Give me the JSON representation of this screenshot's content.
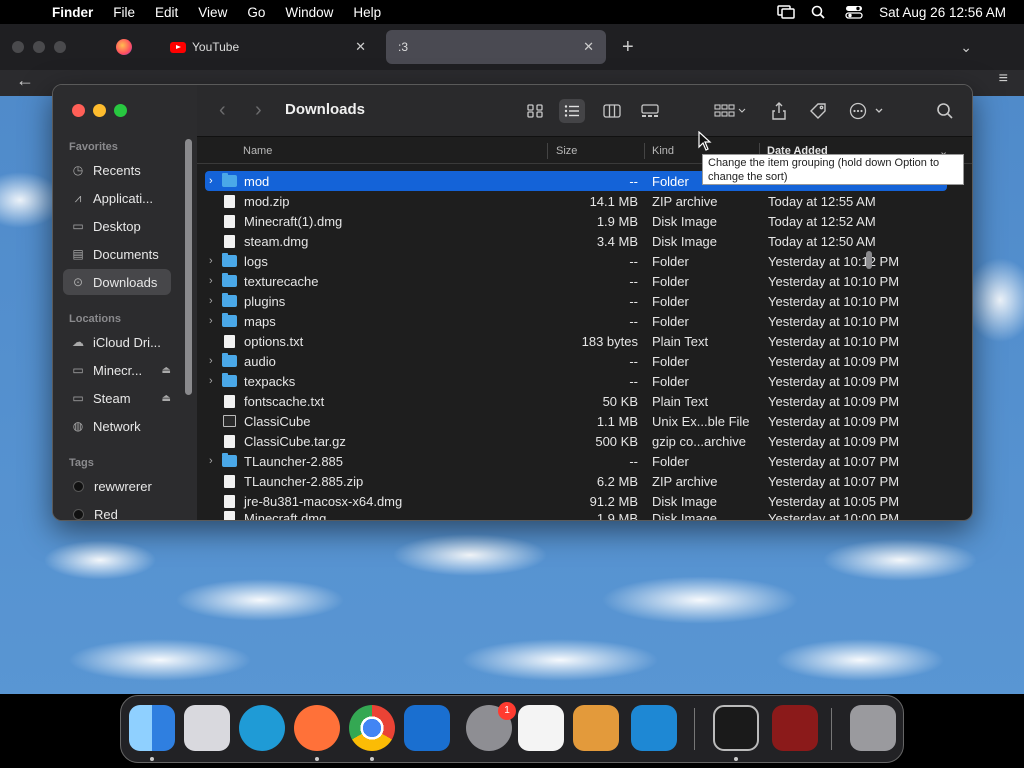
{
  "menubar": {
    "app_name": "Finder",
    "items": [
      "File",
      "Edit",
      "View",
      "Go",
      "Window",
      "Help"
    ],
    "datetime": "Sat Aug 26  12:56 AM"
  },
  "browser": {
    "tabs": [
      {
        "title": "YouTube"
      },
      {
        "title": ":3"
      }
    ]
  },
  "finder": {
    "title": "Downloads",
    "sidebar": {
      "favorites_heading": "Favorites",
      "favorites": [
        {
          "label": "Recents",
          "icon": "clock-icon"
        },
        {
          "label": "Applicati...",
          "icon": "applications-icon"
        },
        {
          "label": "Desktop",
          "icon": "desktop-icon"
        },
        {
          "label": "Documents",
          "icon": "document-icon"
        },
        {
          "label": "Downloads",
          "icon": "download-icon",
          "selected": true
        }
      ],
      "locations_heading": "Locations",
      "locations": [
        {
          "label": "iCloud Dri...",
          "icon": "cloud-icon"
        },
        {
          "label": "Minecr...",
          "icon": "drive-icon",
          "eject": true
        },
        {
          "label": "Steam",
          "icon": "drive-icon",
          "eject": true
        },
        {
          "label": "Network",
          "icon": "network-icon"
        }
      ],
      "tags_heading": "Tags",
      "tags": [
        {
          "label": "rewwrerer",
          "color": "#1a1a1a"
        },
        {
          "label": "Red",
          "color": "#1a1a1a"
        }
      ]
    },
    "columns": {
      "name": "Name",
      "size": "Size",
      "kind": "Kind",
      "date": "Date Added"
    },
    "tooltip": "Change the item grouping (hold down Option to change the sort)",
    "files": [
      {
        "name": "mod",
        "size": "--",
        "kind": "Folder",
        "date": "",
        "type": "folder",
        "selected": true
      },
      {
        "name": "mod.zip",
        "size": "14.1 MB",
        "kind": "ZIP archive",
        "date": "Today at 12:55 AM",
        "type": "doc"
      },
      {
        "name": "Minecraft(1).dmg",
        "size": "1.9 MB",
        "kind": "Disk Image",
        "date": "Today at 12:52 AM",
        "type": "doc"
      },
      {
        "name": "steam.dmg",
        "size": "3.4 MB",
        "kind": "Disk Image",
        "date": "Today at 12:50 AM",
        "type": "doc"
      },
      {
        "name": "logs",
        "size": "--",
        "kind": "Folder",
        "date": "Yesterday at 10:12 PM",
        "type": "folder"
      },
      {
        "name": "texturecache",
        "size": "--",
        "kind": "Folder",
        "date": "Yesterday at 10:10 PM",
        "type": "folder"
      },
      {
        "name": "plugins",
        "size": "--",
        "kind": "Folder",
        "date": "Yesterday at 10:10 PM",
        "type": "folder"
      },
      {
        "name": "maps",
        "size": "--",
        "kind": "Folder",
        "date": "Yesterday at 10:10 PM",
        "type": "folder"
      },
      {
        "name": "options.txt",
        "size": "183 bytes",
        "kind": "Plain Text",
        "date": "Yesterday at 10:10 PM",
        "type": "doc"
      },
      {
        "name": "audio",
        "size": "--",
        "kind": "Folder",
        "date": "Yesterday at 10:09 PM",
        "type": "folder"
      },
      {
        "name": "texpacks",
        "size": "--",
        "kind": "Folder",
        "date": "Yesterday at 10:09 PM",
        "type": "folder"
      },
      {
        "name": "fontscache.txt",
        "size": "50 KB",
        "kind": "Plain Text",
        "date": "Yesterday at 10:09 PM",
        "type": "doc"
      },
      {
        "name": "ClassiCube",
        "size": "1.1 MB",
        "kind": "Unix Ex...ble File",
        "date": "Yesterday at 10:09 PM",
        "type": "exe"
      },
      {
        "name": "ClassiCube.tar.gz",
        "size": "500 KB",
        "kind": "gzip co...archive",
        "date": "Yesterday at 10:09 PM",
        "type": "doc"
      },
      {
        "name": "TLauncher-2.885",
        "size": "--",
        "kind": "Folder",
        "date": "Yesterday at 10:07 PM",
        "type": "folder"
      },
      {
        "name": "TLauncher-2.885.zip",
        "size": "6.2 MB",
        "kind": "ZIP archive",
        "date": "Yesterday at 10:07 PM",
        "type": "doc"
      },
      {
        "name": "jre-8u381-macosx-x64.dmg",
        "size": "91.2 MB",
        "kind": "Disk Image",
        "date": "Yesterday at 10:05 PM",
        "type": "doc"
      },
      {
        "name": "Minecraft.dmg",
        "size": "1.9 MB",
        "kind": "Disk Image",
        "date": "Yesterday at 10:00 PM",
        "type": "doc"
      }
    ]
  },
  "dock": {
    "apps": [
      {
        "name": "finder",
        "color": "#3b8ee8"
      },
      {
        "name": "launchpad",
        "color": "#d9d9de"
      },
      {
        "name": "edge",
        "color": "#1f9bd6"
      },
      {
        "name": "firefox",
        "color": "#ff7139"
      },
      {
        "name": "chrome",
        "color": "#e8e8e8"
      },
      {
        "name": "microsoft-store",
        "color": "#1a6fd0"
      },
      {
        "name": "system-settings",
        "color": "#8e8e93",
        "badge": "1"
      },
      {
        "name": "textedit",
        "color": "#f4f4f4"
      },
      {
        "name": "garageband",
        "color": "#e39a3b"
      },
      {
        "name": "vscode",
        "color": "#1e88d4"
      },
      {
        "name": "terminal",
        "color": "#1a1a1a"
      },
      {
        "name": "wine",
        "color": "#8b1a1a"
      },
      {
        "name": "trash",
        "color": "#9a9a9e"
      }
    ]
  }
}
